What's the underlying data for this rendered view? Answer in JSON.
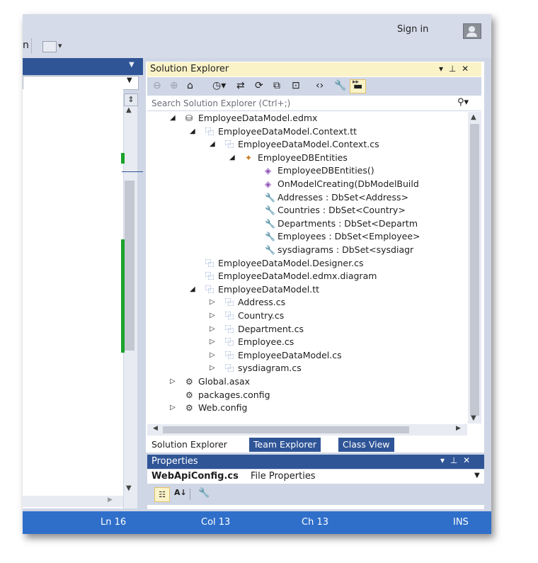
{
  "header": {
    "sign_in": "Sign in",
    "menu_fragment": "n"
  },
  "solution_explorer": {
    "title": "Solution Explorer",
    "window_controls": "▾ ⊥ ✕",
    "search_placeholder": "Search Solution Explorer (Ctrl+;)",
    "toolbar_icons": [
      "back-icon",
      "forward-icon",
      "home-icon",
      "history-icon",
      "sync-icon",
      "refresh-icon",
      "collapse-all-icon",
      "show-all-files-icon",
      "view-code-icon",
      "properties-icon",
      "preview-icon"
    ],
    "tree": [
      {
        "indent": 0,
        "exp": "◢",
        "icon": "edmx",
        "glyph": "⛁",
        "label": "EmployeeDataModel.edmx"
      },
      {
        "indent": 1,
        "exp": "◢",
        "icon": "cs",
        "glyph": "⿻",
        "label": "EmployeeDataModel.Context.tt"
      },
      {
        "indent": 2,
        "exp": "◢",
        "icon": "cs",
        "glyph": "⿻",
        "label": "EmployeeDataModel.Context.cs"
      },
      {
        "indent": 3,
        "exp": "◢",
        "icon": "cls",
        "glyph": "✦",
        "label": "EmployeeDBEntities"
      },
      {
        "indent": 4,
        "exp": "",
        "icon": "m",
        "glyph": "◈",
        "label": "EmployeeDBEntities()"
      },
      {
        "indent": 4,
        "exp": "",
        "icon": "m",
        "glyph": "◈",
        "label": "OnModelCreating(DbModelBuild"
      },
      {
        "indent": 4,
        "exp": "",
        "icon": "p",
        "glyph": "🔧",
        "label": "Addresses : DbSet<Address>"
      },
      {
        "indent": 4,
        "exp": "",
        "icon": "p",
        "glyph": "🔧",
        "label": "Countries : DbSet<Country>"
      },
      {
        "indent": 4,
        "exp": "",
        "icon": "p",
        "glyph": "🔧",
        "label": "Departments : DbSet<Departm"
      },
      {
        "indent": 4,
        "exp": "",
        "icon": "p",
        "glyph": "🔧",
        "label": "Employees : DbSet<Employee>"
      },
      {
        "indent": 4,
        "exp": "",
        "icon": "p",
        "glyph": "🔧",
        "label": "sysdiagrams : DbSet<sysdiagr"
      },
      {
        "indent": 1,
        "exp": "",
        "icon": "cs",
        "glyph": "⿻",
        "label": "EmployeeDataModel.Designer.cs"
      },
      {
        "indent": 1,
        "exp": "",
        "icon": "cs",
        "glyph": "⿻",
        "label": "EmployeeDataModel.edmx.diagram"
      },
      {
        "indent": 1,
        "exp": "◢",
        "icon": "cs",
        "glyph": "⿻",
        "label": "EmployeeDataModel.tt"
      },
      {
        "indent": 2,
        "exp": "▷",
        "icon": "cs",
        "glyph": "⿻",
        "label": "Address.cs"
      },
      {
        "indent": 2,
        "exp": "▷",
        "icon": "cs",
        "glyph": "⿻",
        "label": "Country.cs"
      },
      {
        "indent": 2,
        "exp": "▷",
        "icon": "cs",
        "glyph": "⿻",
        "label": "Department.cs"
      },
      {
        "indent": 2,
        "exp": "▷",
        "icon": "cs",
        "glyph": "⿻",
        "label": "Employee.cs"
      },
      {
        "indent": 2,
        "exp": "▷",
        "icon": "cs",
        "glyph": "⿻",
        "label": "EmployeeDataModel.cs"
      },
      {
        "indent": 2,
        "exp": "▷",
        "icon": "cs",
        "glyph": "⿻",
        "label": "sysdiagram.cs"
      },
      {
        "indent": 0,
        "exp": "▷",
        "icon": "cfg",
        "glyph": "⚙",
        "label": "Global.asax"
      },
      {
        "indent": 0,
        "exp": "",
        "icon": "cfg",
        "glyph": "⚙",
        "label": "packages.config"
      },
      {
        "indent": 0,
        "exp": "▷",
        "icon": "cfg",
        "glyph": "⚙",
        "label": "Web.config"
      }
    ]
  },
  "tabs": [
    {
      "label": "Solution Explorer",
      "active": true
    },
    {
      "label": "Team Explorer",
      "active": false
    },
    {
      "label": "Class View",
      "active": false
    }
  ],
  "properties": {
    "title": "Properties",
    "window_controls": "▾ ⊥ ✕",
    "object_name": "WebApiConfig.cs",
    "object_type": "File Properties"
  },
  "status_bar": {
    "line": "Ln 16",
    "col": "Col 13",
    "ch": "Ch 13",
    "mode": "INS"
  },
  "colors": {
    "accent": "#2f5597",
    "status": "#2f6fca",
    "highlight_tab": "#fbf3c8",
    "change_marker": "#1aa32a"
  }
}
